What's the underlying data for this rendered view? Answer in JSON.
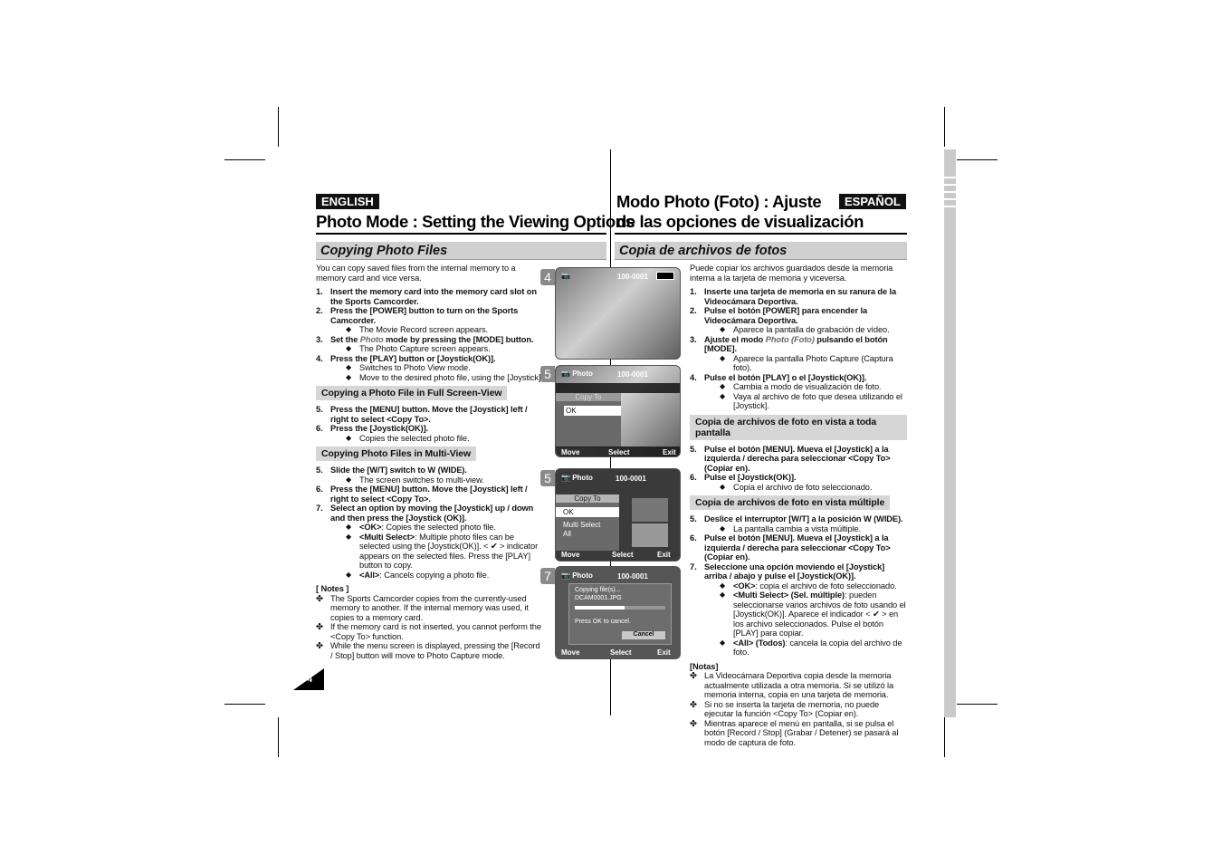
{
  "english": {
    "badge": "ENGLISH",
    "title": "Photo Mode : Setting the Viewing Options",
    "section": "Copying Photo Files",
    "blocks": [
      {
        "type": "p",
        "parts": [
          {
            "t": "You can copy saved files from the internal memory to a memory card and vice versa."
          }
        ]
      },
      {
        "type": "step",
        "n": "1.",
        "parts": [
          {
            "t": "Insert the memory card into the memory card slot on the Sports Camcorder."
          }
        ]
      },
      {
        "type": "step",
        "n": "2.",
        "parts": [
          {
            "t": "Press the [POWER] button to turn on the Sports Camcorder."
          }
        ],
        "subs": [
          [
            {
              "t": "The Movie Record screen appears."
            }
          ]
        ]
      },
      {
        "type": "step",
        "n": "3.",
        "parts": [
          {
            "t": "Set the "
          },
          {
            "t": "Photo",
            "i": true
          },
          {
            "t": " mode by pressing the [MODE] button."
          }
        ],
        "subs": [
          [
            {
              "t": "The Photo Capture screen appears."
            }
          ]
        ]
      },
      {
        "type": "step",
        "n": "4.",
        "parts": [
          {
            "t": "Press the [PLAY] button or [Joystick(OK)]."
          }
        ],
        "subs": [
          [
            {
              "t": "Switches to Photo View mode."
            }
          ],
          [
            {
              "t": "Move to the desired photo file, using the [Joystick]."
            }
          ]
        ]
      },
      {
        "type": "subhead",
        "parts": [
          {
            "t": "Copying  a Photo File in Full Screen-View"
          }
        ]
      },
      {
        "type": "step",
        "n": "5.",
        "parts": [
          {
            "t": "Press the [MENU] button. Move the [Joystick] left / right to select <Copy To>."
          }
        ]
      },
      {
        "type": "step",
        "n": "6.",
        "parts": [
          {
            "t": "Press the [Joystick(OK)]."
          }
        ],
        "subs": [
          [
            {
              "t": "Copies the selected photo file."
            }
          ]
        ]
      },
      {
        "type": "subhead",
        "parts": [
          {
            "t": "Copying  Photo Files in Multi-View"
          }
        ]
      },
      {
        "type": "step",
        "n": "5.",
        "parts": [
          {
            "t": "Slide the [W/T] switch to W (WIDE)."
          }
        ],
        "subs": [
          [
            {
              "t": "The screen switches to multi-view."
            }
          ]
        ]
      },
      {
        "type": "step",
        "n": "6.",
        "parts": [
          {
            "t": "Press the [MENU] button. Move the [Joystick] left / right to select <Copy To>."
          }
        ]
      },
      {
        "type": "step",
        "n": "7.",
        "parts": [
          {
            "t": "Select an option by moving the [Joystick] up / down and then press the [Joystick (OK)]."
          }
        ],
        "subs": [
          [
            {
              "t": "<OK>",
              "b": true
            },
            {
              "t": ": Copies the selected photo file."
            }
          ],
          [
            {
              "t": "<Multi Select>",
              "b": true
            },
            {
              "t": ": Multiple photo files can be selected using the [Joystick(OK)]. < ✔ > indicator appears on the selected files. Press the [PLAY] button to copy."
            }
          ],
          [
            {
              "t": "<All>",
              "b": true
            },
            {
              "t": ": Cancels copying a photo file."
            }
          ]
        ]
      },
      {
        "type": "notes_title",
        "parts": [
          {
            "t": "[ Notes ]"
          }
        ]
      },
      {
        "type": "note",
        "parts": [
          {
            "t": "The Sports Camcorder copies from the currently-used memory to another. If the internal memory was used, it copies to a memory card."
          }
        ]
      },
      {
        "type": "note",
        "parts": [
          {
            "t": "If the memory card is not inserted, you cannot perform the <Copy To> function."
          }
        ]
      },
      {
        "type": "note",
        "parts": [
          {
            "t": "While the menu screen is displayed, pressing the [Record / Stop] button will move to Photo Capture mode."
          }
        ]
      }
    ]
  },
  "espanol": {
    "badge": "ESPAÑOL",
    "title_line1": "Modo Photo (Foto) : Ajuste",
    "title_line2": "de las opciones de visualización",
    "section": "Copia de archivos de fotos",
    "blocks": [
      {
        "type": "p",
        "parts": [
          {
            "t": "Puede copiar los archivos guardados desde la memoria interna a la tarjeta de memoria y viceversa."
          }
        ]
      },
      {
        "type": "step",
        "n": "1.",
        "parts": [
          {
            "t": "Inserte una tarjeta de memoria en su ranura de la Videocámara Deportiva."
          }
        ]
      },
      {
        "type": "step",
        "n": "2.",
        "parts": [
          {
            "t": "Pulse el botón [POWER] para encender la Videocámara Deportiva."
          }
        ],
        "subs": [
          [
            {
              "t": "Aparece la pantalla de grabación de vídeo."
            }
          ]
        ]
      },
      {
        "type": "step",
        "n": "3.",
        "parts": [
          {
            "t": "Ajuste el modo "
          },
          {
            "t": "Photo (Foto)",
            "i": true
          },
          {
            "t": " pulsando el botón [MODE]."
          }
        ],
        "subs": [
          [
            {
              "t": "Aparece la pantalla Photo Capture (Captura foto)."
            }
          ]
        ]
      },
      {
        "type": "step",
        "n": "4.",
        "parts": [
          {
            "t": "Pulse el botón [PLAY] o el [Joystick(OK)]."
          }
        ],
        "subs": [
          [
            {
              "t": "Cambia a modo de visualización de foto."
            }
          ],
          [
            {
              "t": "Vaya al archivo de foto que desea utilizando el [Joystick]."
            }
          ]
        ]
      },
      {
        "type": "subhead",
        "parts": [
          {
            "t": "Copia de archivos de foto en vista a toda pantalla"
          }
        ]
      },
      {
        "type": "step",
        "n": "5.",
        "parts": [
          {
            "t": "Pulse el botón [MENU]. Mueva el [Joystick] a la izquierda / derecha para seleccionar <Copy To> (Copiar en)."
          }
        ]
      },
      {
        "type": "step",
        "n": "6.",
        "parts": [
          {
            "t": "Pulse el [Joystick(OK)]."
          }
        ],
        "subs": [
          [
            {
              "t": "Copia el archivo de foto seleccionado."
            }
          ]
        ]
      },
      {
        "type": "subhead",
        "parts": [
          {
            "t": "Copia de archivos de foto en vista múltiple"
          }
        ]
      },
      {
        "type": "step",
        "n": "5.",
        "parts": [
          {
            "t": "Deslice el interruptor [W/T] a la posición W (WIDE)."
          }
        ],
        "subs": [
          [
            {
              "t": "La pantalla cambia a vista múltiple."
            }
          ]
        ]
      },
      {
        "type": "step",
        "n": "6.",
        "parts": [
          {
            "t": "Pulse el botón [MENU]. Mueva el [Joystick] a la izquierda / derecha para seleccionar <Copy To> (Copiar en)."
          }
        ]
      },
      {
        "type": "step",
        "n": "7.",
        "parts": [
          {
            "t": "Seleccione una opción moviendo el [Joystick] arriba / abajo y pulse el [Joystick(OK)]."
          }
        ],
        "subs": [
          [
            {
              "t": "<OK>",
              "b": true
            },
            {
              "t": ": copia el archivo de foto seleccionado."
            }
          ],
          [
            {
              "t": "<Multi Select> (Sel. múltiple)",
              "b": true
            },
            {
              "t": ": pueden seleccionarse varios archivos de foto usando el [Joystick(OK)]. Aparece el indicador < ✔ > en los archivo seleccionados. Pulse el botón [PLAY] para copiar."
            }
          ],
          [
            {
              "t": "<All> (Todos)",
              "b": true
            },
            {
              "t": ": cancela la copia del archivo de foto."
            }
          ]
        ]
      },
      {
        "type": "notes_title",
        "parts": [
          {
            "t": "[Notas]"
          }
        ]
      },
      {
        "type": "note",
        "parts": [
          {
            "t": "La Videocámara Deportiva copia desde la memoria actualmente utilizada a otra memoria. Si se utilizó la memoria interna, copia en una tarjeta de memoria."
          }
        ]
      },
      {
        "type": "note",
        "parts": [
          {
            "t": "Si no se inserta la tarjeta de memoria, no puede ejecutar la función <Copy To> (Copiar en)."
          }
        ]
      },
      {
        "type": "note",
        "parts": [
          {
            "t": "Mientras aparece el menú en pantalla, si se pulsa el botón [Record / Stop] (Grabar / Detener) se pasará al modo de captura de foto."
          }
        ]
      }
    ]
  },
  "screens": [
    {
      "num": "4",
      "file": "100-0001"
    },
    {
      "num": "5",
      "mode": "Photo",
      "file": "100-0001",
      "menu_title": "Copy To",
      "options": [
        "OK"
      ],
      "move": "Move",
      "select": "Select",
      "exit": "Exit"
    },
    {
      "num": "5",
      "mode": "Photo",
      "file": "100-0001",
      "menu_title": "Copy To",
      "options": [
        "OK",
        "Multi Select",
        "All"
      ],
      "move": "Move",
      "select": "Select",
      "exit": "Exit"
    },
    {
      "num": "7",
      "mode": "Photo",
      "file": "100-0001",
      "line1": "Copying file(s)...",
      "line2": "DCAM0001.JPG",
      "progress": 0.55,
      "hint": "Press OK to cancel.",
      "cancel": "Cancel",
      "move": "Move",
      "select": "Select",
      "exit": "Exit"
    }
  ],
  "page_number": "74"
}
